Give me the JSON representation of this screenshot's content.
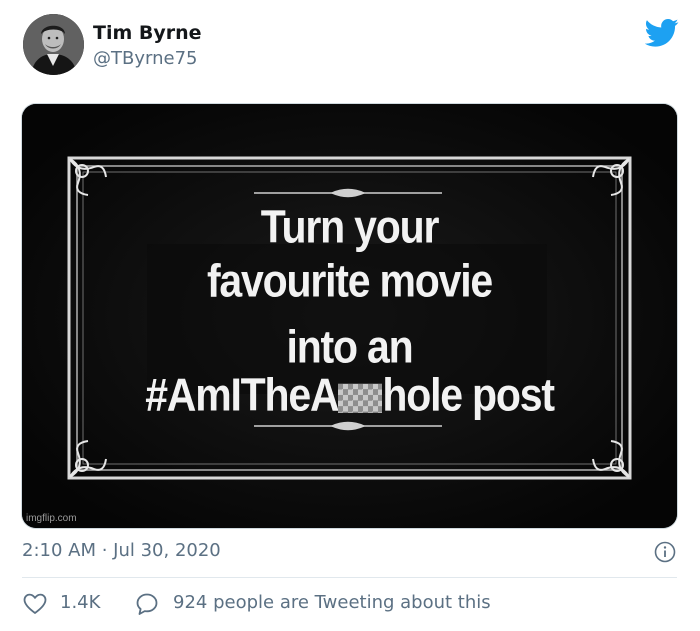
{
  "author": {
    "name": "Tim Byrne",
    "handle": "@TByrne75",
    "avatar_icon": "profile-photo-avatar"
  },
  "brand": {
    "icon": "twitter-bird-icon",
    "color": "#1da1f2"
  },
  "media": {
    "line1": "Turn your",
    "line2": "favourite movie",
    "line3": "into an",
    "line4_before": "#AmITheA",
    "line4_after": "hole post",
    "watermark": "imgflip.com",
    "background": "#050505",
    "text_color": "#f2f2f2"
  },
  "meta": {
    "timestamp": "2:10 AM · Jul 30, 2020",
    "info_icon": "info-icon"
  },
  "actions": {
    "likes": "1.4K",
    "replies_text": "924 people are Tweeting about this",
    "like_icon": "heart-icon",
    "reply_icon": "speech-bubble-icon",
    "muted_color": "#5b7083"
  }
}
